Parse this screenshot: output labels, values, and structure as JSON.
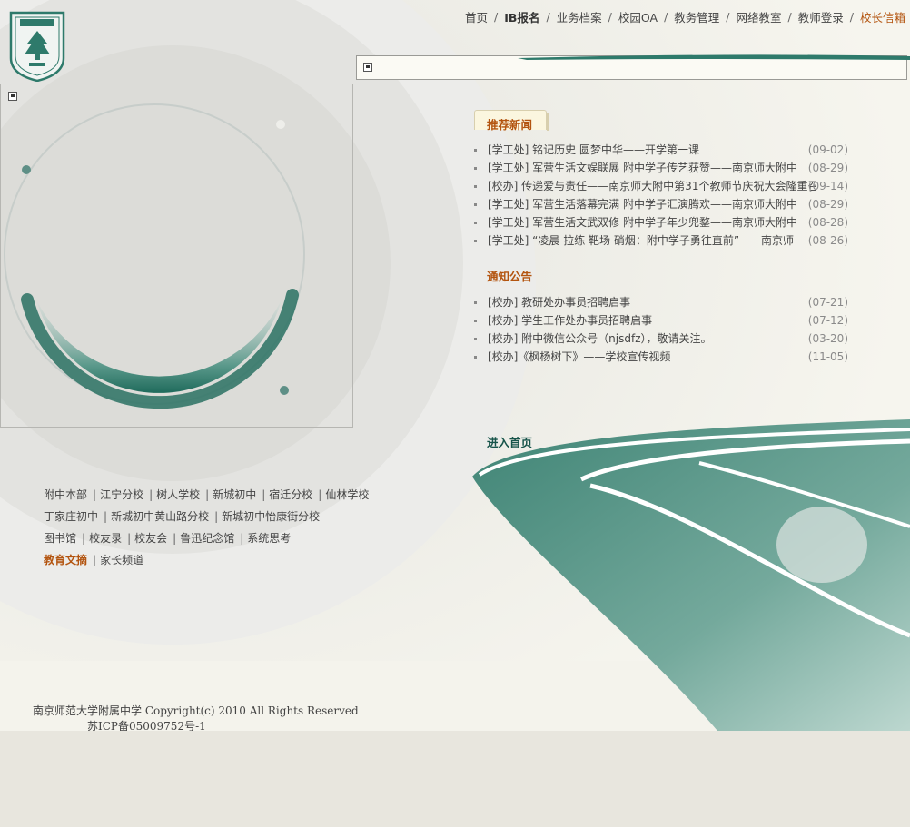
{
  "logo": {
    "alt": "南京师大附中"
  },
  "topnav": {
    "items": [
      {
        "label": "首页",
        "style": "normal"
      },
      {
        "label": "IB报名",
        "style": "bold"
      },
      {
        "label": "业务档案",
        "style": "normal"
      },
      {
        "label": "校园OA",
        "style": "normal"
      },
      {
        "label": "教务管理",
        "style": "normal"
      },
      {
        "label": "网络教室",
        "style": "normal"
      },
      {
        "label": "教师登录",
        "style": "normal"
      },
      {
        "label": "校长信箱",
        "style": "active"
      }
    ],
    "separator": "/"
  },
  "news": {
    "title": "推荐新闻",
    "items": [
      {
        "title": "[学工处] 铭记历史 圆梦中华——开学第一课",
        "date": "(09-02)"
      },
      {
        "title": "[学工处] 军营生活文娱联展 附中学子传艺获赞——南京师大附中",
        "date": "(08-29)"
      },
      {
        "title": "[校办] 传递爱与责任——南京师大附中第31个教师节庆祝大会隆重召",
        "date": "(09-14)"
      },
      {
        "title": "[学工处] 军营生活落幕完满 附中学子汇演腾欢——南京师大附中",
        "date": "(08-29)"
      },
      {
        "title": "[学工处] 军营生活文武双修 附中学子年少兜鍪——南京师大附中",
        "date": "(08-28)"
      },
      {
        "title": "[学工处] “凌晨 拉练 靶场 硝烟：附中学子勇往直前”——南京师",
        "date": "(08-26)"
      }
    ]
  },
  "notices": {
    "title": "通知公告",
    "items": [
      {
        "title": "[校办] 教研处办事员招聘启事",
        "date": "(07-21)"
      },
      {
        "title": "[校办] 学生工作处办事员招聘启事",
        "date": "(07-12)"
      },
      {
        "title": "[校办] 附中微信公众号（njsdfz），敬请关注。",
        "date": "(03-20)"
      },
      {
        "title": "[校办]《枫杨树下》——学校宣传视频",
        "date": "(11-05)"
      }
    ]
  },
  "enter_home": "进入首页",
  "links": {
    "row1": [
      "附中本部",
      "江宁分校",
      "树人学校",
      "新城初中",
      "宿迁分校",
      "仙林学校"
    ],
    "row2": [
      "丁家庄初中",
      "新城初中黄山路分校",
      "新城初中怡康街分校"
    ],
    "row3": [
      "图书馆",
      "校友录",
      "校友会",
      "鲁迅纪念馆",
      "系统思考"
    ],
    "row4": [
      "教育文摘",
      "家长频道"
    ]
  },
  "footer": {
    "line1": "南京师范大学附属中学  Copyright(c) 2010 All Rights Reserved",
    "line2": "苏ICP备05009752号-1"
  },
  "colors": {
    "accent": "#b3540f",
    "teal": "#2d7a6c",
    "background": "#f6f5ee"
  }
}
